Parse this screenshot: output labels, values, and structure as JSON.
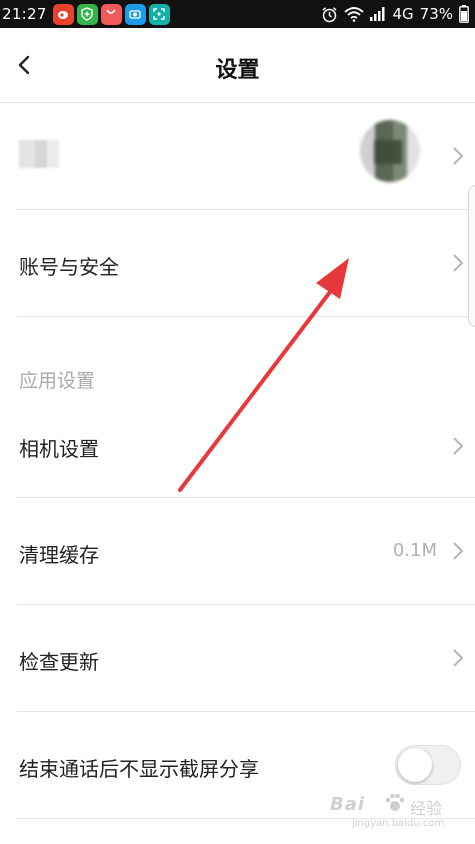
{
  "status_bar": {
    "time": "21:27",
    "network": "4G",
    "battery": "73%",
    "apps": [
      {
        "icon": "weibo-app-icon",
        "color": "#e8412c"
      },
      {
        "icon": "shield-app-icon",
        "color": "#33b44a"
      },
      {
        "icon": "shopping-bag-app-icon",
        "color": "#f05a5a"
      },
      {
        "icon": "camera-app-icon",
        "color": "#1e9be8"
      },
      {
        "icon": "scan-app-icon",
        "color": "#12b0a8"
      }
    ]
  },
  "nav": {
    "title": "设置",
    "back_icon": "chevron-left-icon"
  },
  "rows": {
    "account_security": "账号与安全",
    "section_app_settings": "应用设置",
    "camera_settings": "相机设置",
    "clear_cache": "清理缓存",
    "cache_size": "0.1M",
    "check_update": "检查更新",
    "hide_screenshot_share": "结束通话后不显示截屏分享"
  },
  "toggle": {
    "hide_screenshot_share_on": false
  },
  "watermark": {
    "main": "Bai",
    "suffix": "经验",
    "sub": "jingyan.baidu.com"
  },
  "colors": {
    "annotation_arrow": "#e8393a",
    "divider": "#e6e6e6",
    "secondary_text": "#aaaaaa"
  }
}
